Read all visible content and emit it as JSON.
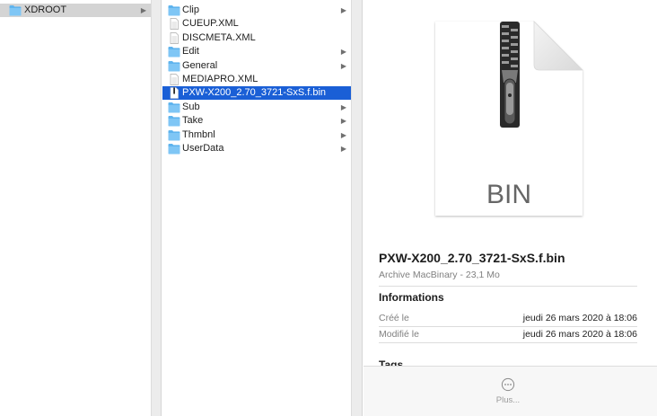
{
  "column1": {
    "items": [
      {
        "label": "XDROOT",
        "type": "folder",
        "has_children": true,
        "selected": true
      }
    ]
  },
  "column2": {
    "items": [
      {
        "label": "Clip",
        "type": "folder",
        "has_children": true
      },
      {
        "label": "CUEUP.XML",
        "type": "file",
        "has_children": false
      },
      {
        "label": "DISCMETA.XML",
        "type": "file",
        "has_children": false
      },
      {
        "label": "Edit",
        "type": "folder",
        "has_children": true
      },
      {
        "label": "General",
        "type": "folder",
        "has_children": true
      },
      {
        "label": "MEDIAPRO.XML",
        "type": "file",
        "has_children": false
      },
      {
        "label": "PXW-X200_2.70_3721-SxS.f.bin",
        "type": "bin",
        "has_children": false,
        "selected": true
      },
      {
        "label": "Sub",
        "type": "folder",
        "has_children": true
      },
      {
        "label": "Take",
        "type": "folder",
        "has_children": true
      },
      {
        "label": "Thmbnl",
        "type": "folder",
        "has_children": true
      },
      {
        "label": "UserData",
        "type": "folder",
        "has_children": true
      }
    ]
  },
  "preview": {
    "doc_label": "BIN",
    "file_name": "PXW-X200_2.70_3721-SxS.f.bin",
    "subtitle": "Archive MacBinary - 23,1 Mo",
    "info_heading": "Informations",
    "created_label": "Créé le",
    "created_value": "jeudi 26 mars 2020 à 18:06",
    "modified_label": "Modifié le",
    "modified_value": "jeudi 26 mars 2020 à 18:06",
    "tags_heading": "Tags",
    "more_label": "Plus..."
  },
  "colors": {
    "selection_blue": "#1a5fd6",
    "selection_gray": "#d4d4d4",
    "folder_blue": "#5fb4ee"
  }
}
